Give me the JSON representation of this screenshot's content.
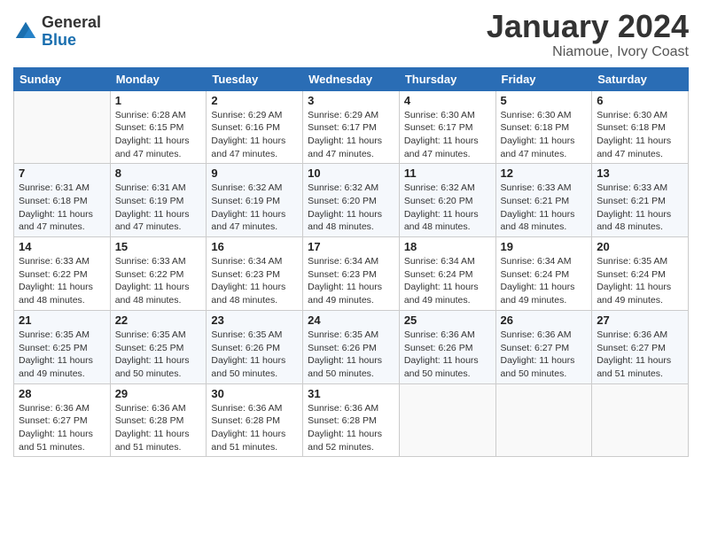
{
  "header": {
    "logo_general": "General",
    "logo_blue": "Blue",
    "title": "January 2024",
    "location": "Niamoue, Ivory Coast"
  },
  "weekdays": [
    "Sunday",
    "Monday",
    "Tuesday",
    "Wednesday",
    "Thursday",
    "Friday",
    "Saturday"
  ],
  "weeks": [
    [
      {
        "day": "",
        "info": ""
      },
      {
        "day": "1",
        "info": "Sunrise: 6:28 AM\nSunset: 6:15 PM\nDaylight: 11 hours and 47 minutes."
      },
      {
        "day": "2",
        "info": "Sunrise: 6:29 AM\nSunset: 6:16 PM\nDaylight: 11 hours and 47 minutes."
      },
      {
        "day": "3",
        "info": "Sunrise: 6:29 AM\nSunset: 6:17 PM\nDaylight: 11 hours and 47 minutes."
      },
      {
        "day": "4",
        "info": "Sunrise: 6:30 AM\nSunset: 6:17 PM\nDaylight: 11 hours and 47 minutes."
      },
      {
        "day": "5",
        "info": "Sunrise: 6:30 AM\nSunset: 6:18 PM\nDaylight: 11 hours and 47 minutes."
      },
      {
        "day": "6",
        "info": "Sunrise: 6:30 AM\nSunset: 6:18 PM\nDaylight: 11 hours and 47 minutes."
      }
    ],
    [
      {
        "day": "7",
        "info": "Sunrise: 6:31 AM\nSunset: 6:18 PM\nDaylight: 11 hours and 47 minutes."
      },
      {
        "day": "8",
        "info": "Sunrise: 6:31 AM\nSunset: 6:19 PM\nDaylight: 11 hours and 47 minutes."
      },
      {
        "day": "9",
        "info": "Sunrise: 6:32 AM\nSunset: 6:19 PM\nDaylight: 11 hours and 47 minutes."
      },
      {
        "day": "10",
        "info": "Sunrise: 6:32 AM\nSunset: 6:20 PM\nDaylight: 11 hours and 48 minutes."
      },
      {
        "day": "11",
        "info": "Sunrise: 6:32 AM\nSunset: 6:20 PM\nDaylight: 11 hours and 48 minutes."
      },
      {
        "day": "12",
        "info": "Sunrise: 6:33 AM\nSunset: 6:21 PM\nDaylight: 11 hours and 48 minutes."
      },
      {
        "day": "13",
        "info": "Sunrise: 6:33 AM\nSunset: 6:21 PM\nDaylight: 11 hours and 48 minutes."
      }
    ],
    [
      {
        "day": "14",
        "info": "Sunrise: 6:33 AM\nSunset: 6:22 PM\nDaylight: 11 hours and 48 minutes."
      },
      {
        "day": "15",
        "info": "Sunrise: 6:33 AM\nSunset: 6:22 PM\nDaylight: 11 hours and 48 minutes."
      },
      {
        "day": "16",
        "info": "Sunrise: 6:34 AM\nSunset: 6:23 PM\nDaylight: 11 hours and 48 minutes."
      },
      {
        "day": "17",
        "info": "Sunrise: 6:34 AM\nSunset: 6:23 PM\nDaylight: 11 hours and 49 minutes."
      },
      {
        "day": "18",
        "info": "Sunrise: 6:34 AM\nSunset: 6:24 PM\nDaylight: 11 hours and 49 minutes."
      },
      {
        "day": "19",
        "info": "Sunrise: 6:34 AM\nSunset: 6:24 PM\nDaylight: 11 hours and 49 minutes."
      },
      {
        "day": "20",
        "info": "Sunrise: 6:35 AM\nSunset: 6:24 PM\nDaylight: 11 hours and 49 minutes."
      }
    ],
    [
      {
        "day": "21",
        "info": "Sunrise: 6:35 AM\nSunset: 6:25 PM\nDaylight: 11 hours and 49 minutes."
      },
      {
        "day": "22",
        "info": "Sunrise: 6:35 AM\nSunset: 6:25 PM\nDaylight: 11 hours and 50 minutes."
      },
      {
        "day": "23",
        "info": "Sunrise: 6:35 AM\nSunset: 6:26 PM\nDaylight: 11 hours and 50 minutes."
      },
      {
        "day": "24",
        "info": "Sunrise: 6:35 AM\nSunset: 6:26 PM\nDaylight: 11 hours and 50 minutes."
      },
      {
        "day": "25",
        "info": "Sunrise: 6:36 AM\nSunset: 6:26 PM\nDaylight: 11 hours and 50 minutes."
      },
      {
        "day": "26",
        "info": "Sunrise: 6:36 AM\nSunset: 6:27 PM\nDaylight: 11 hours and 50 minutes."
      },
      {
        "day": "27",
        "info": "Sunrise: 6:36 AM\nSunset: 6:27 PM\nDaylight: 11 hours and 51 minutes."
      }
    ],
    [
      {
        "day": "28",
        "info": "Sunrise: 6:36 AM\nSunset: 6:27 PM\nDaylight: 11 hours and 51 minutes."
      },
      {
        "day": "29",
        "info": "Sunrise: 6:36 AM\nSunset: 6:28 PM\nDaylight: 11 hours and 51 minutes."
      },
      {
        "day": "30",
        "info": "Sunrise: 6:36 AM\nSunset: 6:28 PM\nDaylight: 11 hours and 51 minutes."
      },
      {
        "day": "31",
        "info": "Sunrise: 6:36 AM\nSunset: 6:28 PM\nDaylight: 11 hours and 52 minutes."
      },
      {
        "day": "",
        "info": ""
      },
      {
        "day": "",
        "info": ""
      },
      {
        "day": "",
        "info": ""
      }
    ]
  ]
}
